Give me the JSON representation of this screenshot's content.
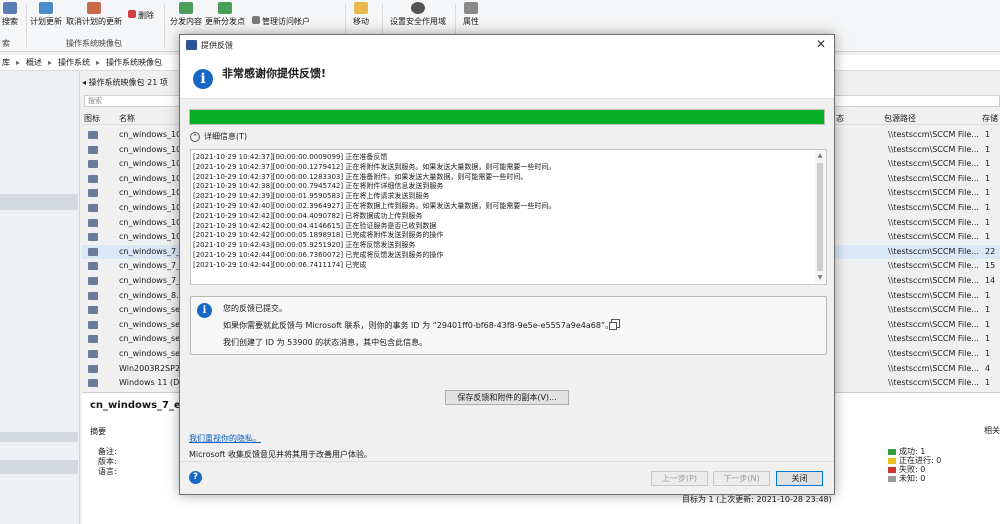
{
  "ribbon": {
    "buttons": [
      {
        "label": "搜索",
        "icon": "search-icon",
        "color": "#5a7fb5"
      },
      {
        "label": "计划更新",
        "icon": "calendar-icon",
        "color": "#4a8cc9"
      },
      {
        "label": "取消计划的更新",
        "icon": "cancel-schedule-icon",
        "color": "#c96a4a"
      },
      {
        "label": "删除",
        "icon": "delete-icon",
        "color": "#d04040"
      },
      {
        "label": "分发内容",
        "icon": "distribute-icon",
        "color": "#4aa05a"
      },
      {
        "label": "更新分发点",
        "icon": "update-dp-icon",
        "color": "#4aa05a"
      },
      {
        "label": "管理访问帐户",
        "icon": "manage-accounts-icon",
        "color": "#7a7a7a"
      },
      {
        "label": "移动",
        "icon": "folder-move-icon",
        "color": "#e8b84a"
      },
      {
        "label": "设置安全作用域",
        "icon": "security-scope-icon",
        "color": "#555555"
      },
      {
        "label": "属性",
        "icon": "properties-icon",
        "color": "#8a8a8a"
      }
    ],
    "groups": [
      "索",
      "操作系统映像包"
    ]
  },
  "breadcrumb": [
    "库",
    "概述",
    "操作系统",
    "操作系统映像包"
  ],
  "list": {
    "title": "操作系统映像包 21 项",
    "search_placeholder": "搜索",
    "columns": {
      "icon": "图标",
      "name": "名称",
      "status": "态",
      "path": "包源路径",
      "count": "存储"
    },
    "rows": [
      {
        "name": "cn_windows_10",
        "path": "\\\\testsccm\\SCCM File...",
        "count": "1",
        "selected": false
      },
      {
        "name": "cn_windows_10",
        "path": "\\\\testsccm\\SCCM File...",
        "count": "1",
        "selected": false
      },
      {
        "name": "cn_windows_10",
        "path": "\\\\testsccm\\SCCM File...",
        "count": "1",
        "selected": false
      },
      {
        "name": "cn_windows_10",
        "path": "\\\\testsccm\\SCCM File...",
        "count": "1",
        "selected": false
      },
      {
        "name": "cn_windows_10",
        "path": "\\\\testsccm\\SCCM File...",
        "count": "1",
        "selected": false
      },
      {
        "name": "cn_windows_10",
        "path": "\\\\testsccm\\SCCM File...",
        "count": "1",
        "selected": false
      },
      {
        "name": "cn_windows_10",
        "path": "\\\\testsccm\\SCCM File...",
        "count": "1",
        "selected": false
      },
      {
        "name": "cn_windows_10",
        "path": "\\\\testsccm\\SCCM File...",
        "count": "1",
        "selected": false
      },
      {
        "name": "cn_windows_7_",
        "path": "\\\\testsccm\\SCCM File...",
        "count": "22",
        "selected": true
      },
      {
        "name": "cn_windows_7_",
        "path": "\\\\testsccm\\SCCM File...",
        "count": "15",
        "selected": false
      },
      {
        "name": "cn_windows_7_",
        "path": "\\\\testsccm\\SCCM File...",
        "count": "14",
        "selected": false
      },
      {
        "name": "cn_windows_8.1",
        "path": "\\\\testsccm\\SCCM File...",
        "count": "1",
        "selected": false
      },
      {
        "name": "cn_windows_se",
        "path": "\\\\testsccm\\SCCM File...",
        "count": "1",
        "selected": false
      },
      {
        "name": "cn_windows_se",
        "path": "\\\\testsccm\\SCCM File...",
        "count": "1",
        "selected": false
      },
      {
        "name": "cn_windows_se",
        "path": "\\\\testsccm\\SCCM File...",
        "count": "1",
        "selected": false
      },
      {
        "name": "cn_windows_se",
        "path": "\\\\testsccm\\SCCM File...",
        "count": "1",
        "selected": false
      },
      {
        "name": "Win2003R2SP2",
        "path": "\\\\testsccm\\SCCM File...",
        "count": "4",
        "selected": false
      },
      {
        "name": "Windows 11 (D",
        "path": "\\\\testsccm\\SCCM File...",
        "count": "1",
        "selected": false
      }
    ]
  },
  "details": {
    "title": "cn_windows_7_ente",
    "summary": "摘要",
    "labels": [
      "备注:",
      "版本:",
      "语言:"
    ],
    "related": "相关",
    "legend": [
      {
        "label": "成功: 1",
        "color": "#2e9d3a"
      },
      {
        "label": "正在进行: 0",
        "color": "#e8c020"
      },
      {
        "label": "失败: 0",
        "color": "#d03030"
      },
      {
        "label": "未知: 0",
        "color": "#9a9a9a"
      }
    ],
    "status_line": "目标为 1 (上次更新: 2021-10-28 23:48)"
  },
  "dialog": {
    "window_title": "提供反馈",
    "heading": "非常感谢你提供反馈!",
    "progress": 1.0,
    "details_toggle": "详细信息(T)",
    "log": [
      "[2021-10-29 10:42:37][00:00:00.0009099] 正在准备反馈",
      "[2021-10-29 10:42:37][00:00:00.1279412] 正在将附件发送到服务。如果发送大量数据，则可能需要一些时间。",
      "[2021-10-29 10:42:37][00:00:00.1283303] 正在准备附件。如果发送大量数据，则可能需要一些时间。",
      "[2021-10-29 10:42:38][00:00:00.7945742] 正在将附件详细信息发送到服务",
      "[2021-10-29 10:42:39][00:00:01.9590583] 正在将上传请求发送到服务",
      "[2021-10-29 10:42:40][00:00:02.3964927] 正在将数据上传到服务。如果发送大量数据，则可能需要一些时间。",
      "[2021-10-29 10:42:42][00:00:04.4090782] 已将数据成功上传到服务",
      "[2021-10-29 10:42:42][00:00:04.4146615] 正在验证服务是否已收到数据",
      "[2021-10-29 10:42:42][00:00:05.1898918] 已完成将附件发送到服务的操作",
      "[2021-10-29 10:42:43][00:00:05.9251920] 正在将反馈发送到服务",
      "[2021-10-29 10:42:44][00:00:06.7360072] 已完成将反馈发送到服务的操作",
      "[2021-10-29 10:42:44][00:00:06.7411174] 已完成"
    ],
    "info": {
      "line1": "您的反馈已提交。",
      "line2": "如果你需要就此反馈与 Microsoft 联系，则你的事务 ID 为 “29401ff0-bf68-43f8-9e5e-e5557a9e4a68”。",
      "line3": "我们创建了 ID 为 53900 的状态消息，其中包含此信息。"
    },
    "save_button": "保存反馈和附件的副本(V)...",
    "privacy_link": "我们重视你的隐私。",
    "footer_text": "Microsoft 收集反馈意见并将其用于改善用户体验。",
    "buttons": {
      "prev": "上一步(P)",
      "next": "下一步(N)",
      "close": "关闭"
    },
    "close_glyph": "✕",
    "help_glyph": "?",
    "info_glyph": "i",
    "progress_color": "#06b025"
  }
}
